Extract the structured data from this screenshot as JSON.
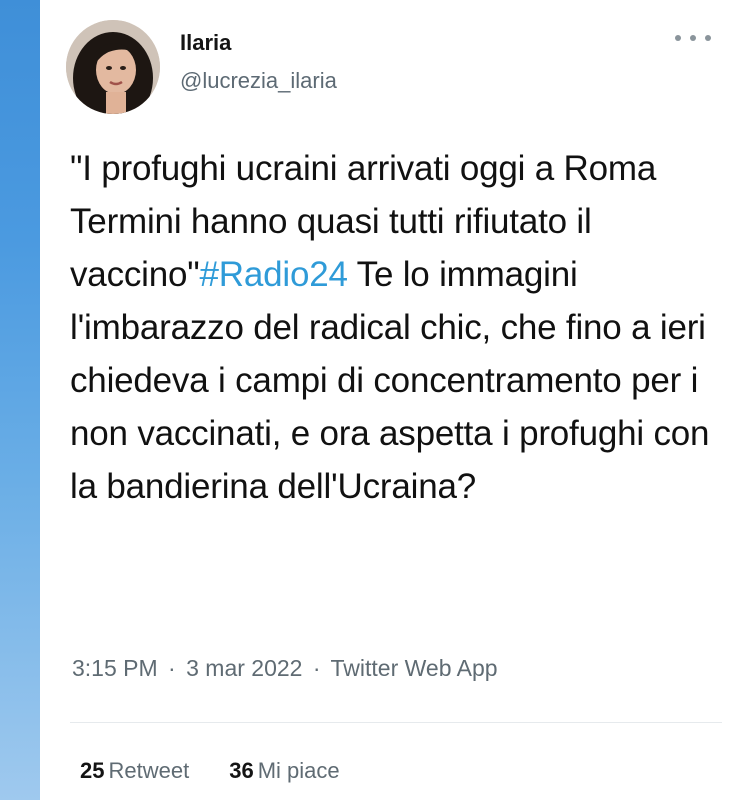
{
  "user": {
    "display_name": "Ilaria",
    "handle": "@lucrezia_ilaria"
  },
  "tweet": {
    "text_before_hashtag": "\"I profughi ucraini arrivati oggi a Roma Termini hanno quasi tutti rifiutato il vaccino\"",
    "hashtag": "#Radio24",
    "text_after_hashtag": " Te lo immagini l'imbarazzo del radical chic, che fino a ieri chiedeva i campi di concentramento per i non vaccinati, e ora aspetta i profughi con la bandierina dell'Ucraina?"
  },
  "meta": {
    "time": "3:15 PM",
    "date": "3 mar 2022",
    "separator": "·",
    "source": "Twitter Web App"
  },
  "stats": {
    "retweets_count": "25",
    "retweets_label": "Retweet",
    "likes_count": "36",
    "likes_label": "Mi piace"
  },
  "icons": {
    "more": "more-horizontal-icon"
  },
  "colors": {
    "hashtag": "#2f9bd8",
    "secondary_text": "#5f6b73",
    "left_strip": "#4b9ae0"
  }
}
